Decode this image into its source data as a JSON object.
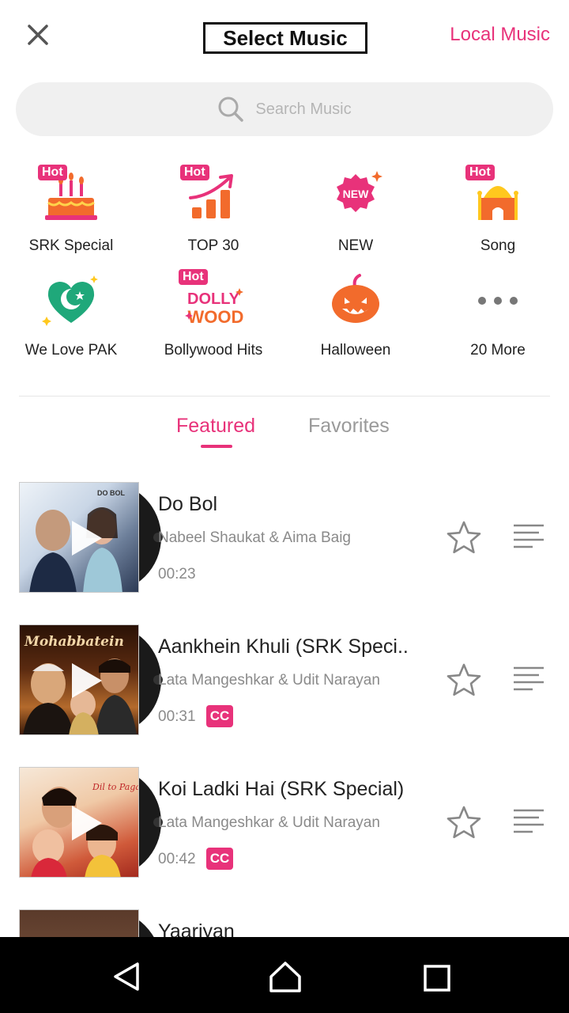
{
  "header": {
    "title": "Select Music",
    "local_music": "Local Music"
  },
  "search": {
    "placeholder": "Search Music"
  },
  "categories": [
    {
      "label": "SRK Special",
      "icon": "cake-icon",
      "badge": "Hot"
    },
    {
      "label": "TOP 30",
      "icon": "trending-chart-icon",
      "badge": "Hot"
    },
    {
      "label": "NEW",
      "icon": "new-badge-icon",
      "badge": "NEW"
    },
    {
      "label": "Song",
      "icon": "mosque-icon",
      "badge": "Hot"
    },
    {
      "label": "We Love PAK",
      "icon": "pakistan-heart-icon"
    },
    {
      "label": "Bollywood Hits",
      "icon": "bollywood-logo-icon",
      "badge": "Hot",
      "logo_text": [
        "DOLLY",
        "WOOD"
      ]
    },
    {
      "label": "Halloween",
      "icon": "pumpkin-icon"
    },
    {
      "label": "20 More",
      "icon": "more-dots-icon"
    }
  ],
  "tabs": [
    {
      "label": "Featured",
      "active": true
    },
    {
      "label": "Favorites",
      "active": false
    }
  ],
  "songs": [
    {
      "title": "Do Bol",
      "artist": "Nabeel Shaukat & Aima Baig",
      "duration": "00:23",
      "cc": null,
      "cover_text": "DO BOL"
    },
    {
      "title": "Aankhein Khuli (SRK Speci..",
      "artist": "Lata Mangeshkar & Udit Narayan",
      "duration": "00:31",
      "cc": "CC",
      "cover_text": "Mohabbatein"
    },
    {
      "title": "Koi Ladki Hai (SRK Special)",
      "artist": "Lata Mangeshkar & Udit Narayan",
      "duration": "00:42",
      "cc": "CC",
      "cover_text": "Dil to Pagal Hai"
    },
    {
      "title": "Yaariyan"
    }
  ],
  "colors": {
    "accent": "#e8327a",
    "secondary_text": "#8a8a8a",
    "search_bg": "#f0f0f0"
  }
}
